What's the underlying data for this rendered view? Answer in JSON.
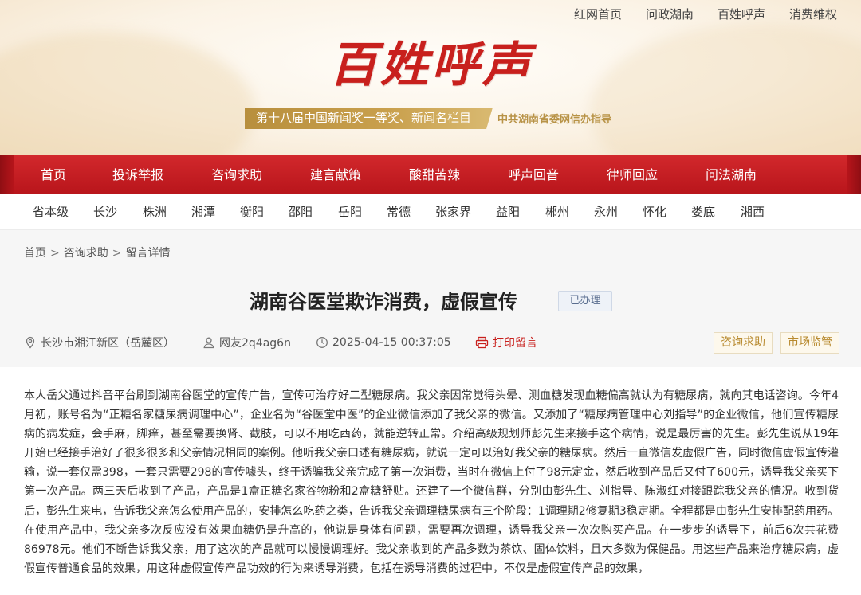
{
  "top_links": [
    "红网首页",
    "问政湖南",
    "百姓呼声",
    "消费维权"
  ],
  "banner": {
    "logo": "百姓呼声",
    "award": "第十八届中国新闻奖一等奖、新闻名栏目",
    "guide": "中共湖南省委网信办指导"
  },
  "main_nav": [
    "首页",
    "投诉举报",
    "咨询求助",
    "建言献策",
    "酸甜苦辣",
    "呼声回音",
    "律师回应",
    "问法湖南"
  ],
  "region_nav": [
    "省本级",
    "长沙",
    "株洲",
    "湘潭",
    "衡阳",
    "邵阳",
    "岳阳",
    "常德",
    "张家界",
    "益阳",
    "郴州",
    "永州",
    "怀化",
    "娄底",
    "湘西"
  ],
  "breadcrumb": [
    "首页",
    "咨询求助",
    "留言详情"
  ],
  "article": {
    "title": "湖南谷医堂欺诈消费，虚假宣传",
    "status": "已办理",
    "location": "长沙市湘江新区（岳麓区）",
    "user": "网友2q4ag6n",
    "datetime": "2025-04-15 00:37:05",
    "print_label": "打印留言",
    "tags": [
      "咨询求助",
      "市场监管"
    ],
    "body": "本人岳父通过抖音平台刷到湖南谷医堂的宣传广告，宣传可治疗好二型糖尿病。我父亲因常觉得头晕、测血糖发现血糖偏高就认为有糖尿病，就向其电话咨询。今年4月初，账号名为“正糖名家糖尿病调理中心”，企业名为“谷医堂中医”的企业微信添加了我父亲的微信。又添加了“糖尿病管理中心刘指导”的企业微信，他们宣传糖尿病的病发症，会手麻，脚痒，甚至需要换肾、截肢，可以不用吃西药，就能逆转正常。介绍高级规划师彭先生来接手这个病情，说是最厉害的先生。彭先生说从19年开始已经接手治好了很多很多和父亲情况相同的案例。他听我父亲口述有糖尿病，就说一定可以治好我父亲的糖尿病。然后一直微信发虚假广告，同时微信虚假宣传灌输，说一套仅需398，一套只需要298的宣传噱头，终于诱骗我父亲完成了第一次消费，当时在微信上付了98元定金，然后收到产品后又付了600元，诱导我父亲买下第一次产品。两三天后收到了产品，产品是1盒正糖名家谷物粉和2盒糖舒贴。还建了一个微信群，分别由彭先生、刘指导、陈淑红对接跟踪我父亲的情况。收到货后，彭先生来电，告诉我父亲怎么使用产品的，安排怎么吃药之类，告诉我父亲调理糖尿病有三个阶段：1调理期2修复期3稳定期。全程都是由彭先生安排配药用药。在使用产品中，我父亲多次反应没有效果血糖仍是升高的，他说是身体有问题，需要再次调理，诱导我父亲一次次购买产品。在一步步的诱导下，前后6次共花费86978元。他们不断告诉我父亲，用了这次的产品就可以慢慢调理好。我父亲收到的产品多数为茶饮、固体饮料，且大多数为保健品。用这些产品来治疗糖尿病，虚假宣传普通食品的效果，用这种虚假宣传产品功效的行为来诱导消费，包括在诱导消费的过程中，不仅是虚假宣传产品的效果，"
  },
  "colors": {
    "brand_red": "#c8201d",
    "nav_red": "#b8151b",
    "gold": "#b88f3d"
  }
}
